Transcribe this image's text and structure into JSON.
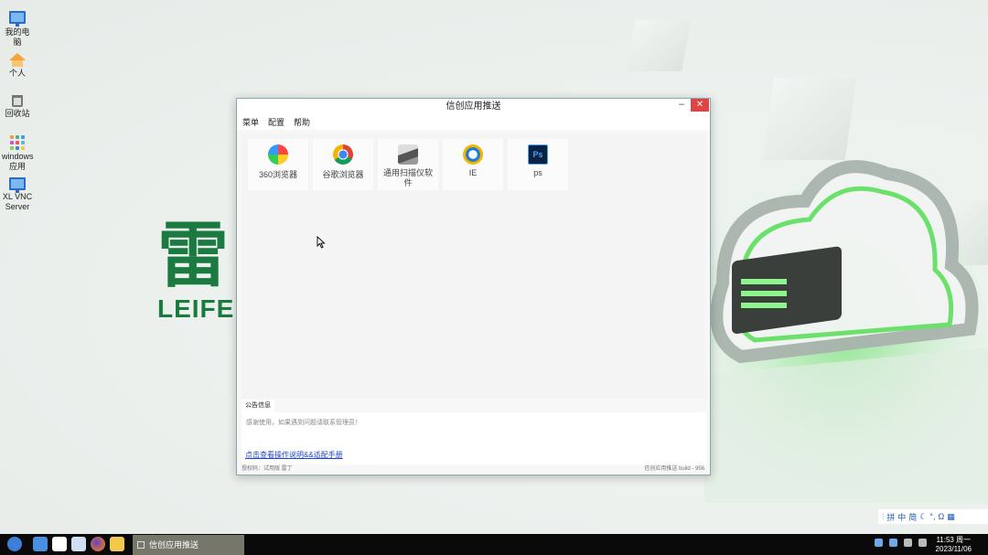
{
  "desktop": {
    "icons": [
      {
        "label": "我的电脑"
      },
      {
        "label": "个人"
      },
      {
        "label": "回收站"
      },
      {
        "label": "windows应用"
      },
      {
        "label": "XL VNC Server"
      }
    ],
    "brand": {
      "glyph": "雷",
      "name": "LEIFEN"
    }
  },
  "window": {
    "title": "信创应用推送",
    "menu": [
      "菜单",
      "配置",
      "帮助"
    ],
    "apps": [
      {
        "label": "360浏览器",
        "icon": "360-browser-icon"
      },
      {
        "label": "谷歌浏览器",
        "icon": "chrome-icon"
      },
      {
        "label": "通用扫描仪软件",
        "icon": "scanner-icon"
      },
      {
        "label": "IE",
        "icon": "ie-icon"
      },
      {
        "label": "ps",
        "icon": "photoshop-icon"
      }
    ],
    "notice_tab": "公告信息",
    "notice_text": "感谢使用，如果遇到问题请联系管理员！",
    "manual_link": "点击查看操作说明&&适配手册",
    "status_left": "授权码：试用版 雷丁",
    "status_right": "信创应用推送 build - 956"
  },
  "ime": {
    "items": [
      "拼",
      "中",
      "简"
    ]
  },
  "taskbar": {
    "active_window": "信创应用推送",
    "clock_time": "11:53 周一",
    "clock_date": "2023/11/06"
  },
  "colors": {
    "brand_green": "#1b7a3f",
    "close_red": "#e04343",
    "link_blue": "#2046c8"
  }
}
